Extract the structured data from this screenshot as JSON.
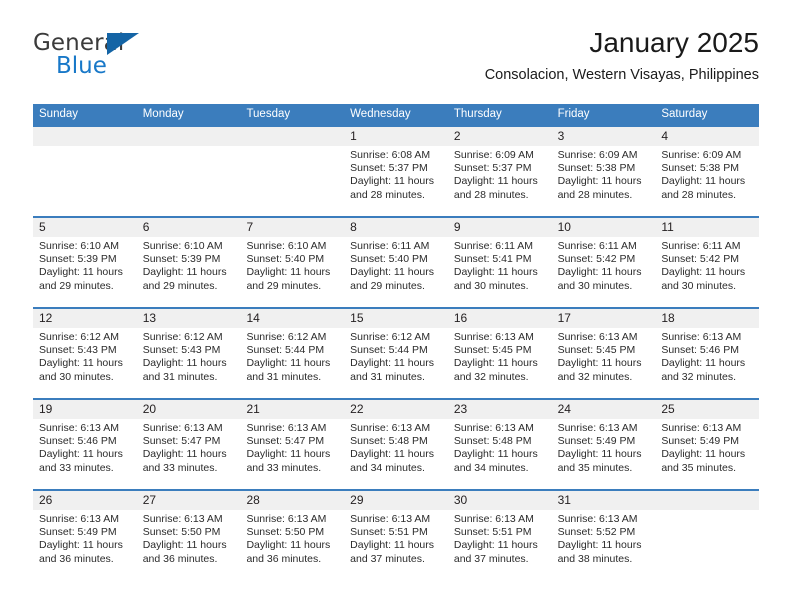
{
  "brand": {
    "name_part1": "General",
    "name_part2": "Blue",
    "triangle_color": "#1464a5",
    "blue_text_color": "#1878c8"
  },
  "header": {
    "title": "January 2025",
    "location": "Consolacion, Western Visayas, Philippines"
  },
  "theme": {
    "header_blue": "#3b7dbd",
    "day_band_gray": "#f0f0f0",
    "text_color": "#231f20"
  },
  "weekdays": [
    "Sunday",
    "Monday",
    "Tuesday",
    "Wednesday",
    "Thursday",
    "Friday",
    "Saturday"
  ],
  "weeks": [
    {
      "days": [
        {
          "num": "",
          "sunrise": "",
          "sunset": "",
          "daylight_1": "",
          "daylight_2": ""
        },
        {
          "num": "",
          "sunrise": "",
          "sunset": "",
          "daylight_1": "",
          "daylight_2": ""
        },
        {
          "num": "",
          "sunrise": "",
          "sunset": "",
          "daylight_1": "",
          "daylight_2": ""
        },
        {
          "num": "1",
          "sunrise": "Sunrise: 6:08 AM",
          "sunset": "Sunset: 5:37 PM",
          "daylight_1": "Daylight: 11 hours",
          "daylight_2": "and 28 minutes."
        },
        {
          "num": "2",
          "sunrise": "Sunrise: 6:09 AM",
          "sunset": "Sunset: 5:37 PM",
          "daylight_1": "Daylight: 11 hours",
          "daylight_2": "and 28 minutes."
        },
        {
          "num": "3",
          "sunrise": "Sunrise: 6:09 AM",
          "sunset": "Sunset: 5:38 PM",
          "daylight_1": "Daylight: 11 hours",
          "daylight_2": "and 28 minutes."
        },
        {
          "num": "4",
          "sunrise": "Sunrise: 6:09 AM",
          "sunset": "Sunset: 5:38 PM",
          "daylight_1": "Daylight: 11 hours",
          "daylight_2": "and 28 minutes."
        }
      ]
    },
    {
      "days": [
        {
          "num": "5",
          "sunrise": "Sunrise: 6:10 AM",
          "sunset": "Sunset: 5:39 PM",
          "daylight_1": "Daylight: 11 hours",
          "daylight_2": "and 29 minutes."
        },
        {
          "num": "6",
          "sunrise": "Sunrise: 6:10 AM",
          "sunset": "Sunset: 5:39 PM",
          "daylight_1": "Daylight: 11 hours",
          "daylight_2": "and 29 minutes."
        },
        {
          "num": "7",
          "sunrise": "Sunrise: 6:10 AM",
          "sunset": "Sunset: 5:40 PM",
          "daylight_1": "Daylight: 11 hours",
          "daylight_2": "and 29 minutes."
        },
        {
          "num": "8",
          "sunrise": "Sunrise: 6:11 AM",
          "sunset": "Sunset: 5:40 PM",
          "daylight_1": "Daylight: 11 hours",
          "daylight_2": "and 29 minutes."
        },
        {
          "num": "9",
          "sunrise": "Sunrise: 6:11 AM",
          "sunset": "Sunset: 5:41 PM",
          "daylight_1": "Daylight: 11 hours",
          "daylight_2": "and 30 minutes."
        },
        {
          "num": "10",
          "sunrise": "Sunrise: 6:11 AM",
          "sunset": "Sunset: 5:42 PM",
          "daylight_1": "Daylight: 11 hours",
          "daylight_2": "and 30 minutes."
        },
        {
          "num": "11",
          "sunrise": "Sunrise: 6:11 AM",
          "sunset": "Sunset: 5:42 PM",
          "daylight_1": "Daylight: 11 hours",
          "daylight_2": "and 30 minutes."
        }
      ]
    },
    {
      "days": [
        {
          "num": "12",
          "sunrise": "Sunrise: 6:12 AM",
          "sunset": "Sunset: 5:43 PM",
          "daylight_1": "Daylight: 11 hours",
          "daylight_2": "and 30 minutes."
        },
        {
          "num": "13",
          "sunrise": "Sunrise: 6:12 AM",
          "sunset": "Sunset: 5:43 PM",
          "daylight_1": "Daylight: 11 hours",
          "daylight_2": "and 31 minutes."
        },
        {
          "num": "14",
          "sunrise": "Sunrise: 6:12 AM",
          "sunset": "Sunset: 5:44 PM",
          "daylight_1": "Daylight: 11 hours",
          "daylight_2": "and 31 minutes."
        },
        {
          "num": "15",
          "sunrise": "Sunrise: 6:12 AM",
          "sunset": "Sunset: 5:44 PM",
          "daylight_1": "Daylight: 11 hours",
          "daylight_2": "and 31 minutes."
        },
        {
          "num": "16",
          "sunrise": "Sunrise: 6:13 AM",
          "sunset": "Sunset: 5:45 PM",
          "daylight_1": "Daylight: 11 hours",
          "daylight_2": "and 32 minutes."
        },
        {
          "num": "17",
          "sunrise": "Sunrise: 6:13 AM",
          "sunset": "Sunset: 5:45 PM",
          "daylight_1": "Daylight: 11 hours",
          "daylight_2": "and 32 minutes."
        },
        {
          "num": "18",
          "sunrise": "Sunrise: 6:13 AM",
          "sunset": "Sunset: 5:46 PM",
          "daylight_1": "Daylight: 11 hours",
          "daylight_2": "and 32 minutes."
        }
      ]
    },
    {
      "days": [
        {
          "num": "19",
          "sunrise": "Sunrise: 6:13 AM",
          "sunset": "Sunset: 5:46 PM",
          "daylight_1": "Daylight: 11 hours",
          "daylight_2": "and 33 minutes."
        },
        {
          "num": "20",
          "sunrise": "Sunrise: 6:13 AM",
          "sunset": "Sunset: 5:47 PM",
          "daylight_1": "Daylight: 11 hours",
          "daylight_2": "and 33 minutes."
        },
        {
          "num": "21",
          "sunrise": "Sunrise: 6:13 AM",
          "sunset": "Sunset: 5:47 PM",
          "daylight_1": "Daylight: 11 hours",
          "daylight_2": "and 33 minutes."
        },
        {
          "num": "22",
          "sunrise": "Sunrise: 6:13 AM",
          "sunset": "Sunset: 5:48 PM",
          "daylight_1": "Daylight: 11 hours",
          "daylight_2": "and 34 minutes."
        },
        {
          "num": "23",
          "sunrise": "Sunrise: 6:13 AM",
          "sunset": "Sunset: 5:48 PM",
          "daylight_1": "Daylight: 11 hours",
          "daylight_2": "and 34 minutes."
        },
        {
          "num": "24",
          "sunrise": "Sunrise: 6:13 AM",
          "sunset": "Sunset: 5:49 PM",
          "daylight_1": "Daylight: 11 hours",
          "daylight_2": "and 35 minutes."
        },
        {
          "num": "25",
          "sunrise": "Sunrise: 6:13 AM",
          "sunset": "Sunset: 5:49 PM",
          "daylight_1": "Daylight: 11 hours",
          "daylight_2": "and 35 minutes."
        }
      ]
    },
    {
      "days": [
        {
          "num": "26",
          "sunrise": "Sunrise: 6:13 AM",
          "sunset": "Sunset: 5:49 PM",
          "daylight_1": "Daylight: 11 hours",
          "daylight_2": "and 36 minutes."
        },
        {
          "num": "27",
          "sunrise": "Sunrise: 6:13 AM",
          "sunset": "Sunset: 5:50 PM",
          "daylight_1": "Daylight: 11 hours",
          "daylight_2": "and 36 minutes."
        },
        {
          "num": "28",
          "sunrise": "Sunrise: 6:13 AM",
          "sunset": "Sunset: 5:50 PM",
          "daylight_1": "Daylight: 11 hours",
          "daylight_2": "and 36 minutes."
        },
        {
          "num": "29",
          "sunrise": "Sunrise: 6:13 AM",
          "sunset": "Sunset: 5:51 PM",
          "daylight_1": "Daylight: 11 hours",
          "daylight_2": "and 37 minutes."
        },
        {
          "num": "30",
          "sunrise": "Sunrise: 6:13 AM",
          "sunset": "Sunset: 5:51 PM",
          "daylight_1": "Daylight: 11 hours",
          "daylight_2": "and 37 minutes."
        },
        {
          "num": "31",
          "sunrise": "Sunrise: 6:13 AM",
          "sunset": "Sunset: 5:52 PM",
          "daylight_1": "Daylight: 11 hours",
          "daylight_2": "and 38 minutes."
        },
        {
          "num": "",
          "sunrise": "",
          "sunset": "",
          "daylight_1": "",
          "daylight_2": ""
        }
      ]
    }
  ]
}
